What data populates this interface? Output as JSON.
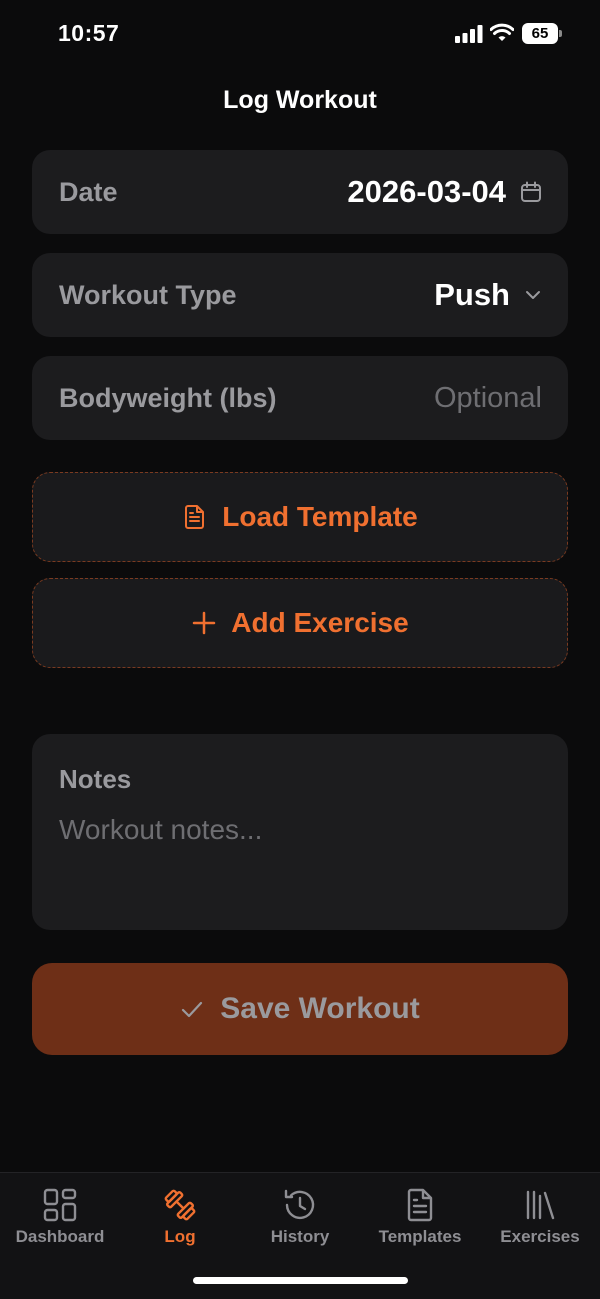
{
  "status_bar": {
    "time": "10:57",
    "battery": "65"
  },
  "header": {
    "title": "Log Workout"
  },
  "form": {
    "date": {
      "label": "Date",
      "value": "2026-03-04",
      "icon": "calendar-icon"
    },
    "workout_type": {
      "label": "Workout Type",
      "value": "Push",
      "icon": "chevron-down-icon"
    },
    "bodyweight": {
      "label": "Bodyweight (lbs)",
      "placeholder": "Optional"
    }
  },
  "actions": {
    "load_template": {
      "label": "Load Template",
      "icon": "document-icon"
    },
    "add_exercise": {
      "label": "Add Exercise",
      "icon": "plus-icon"
    }
  },
  "notes": {
    "label": "Notes",
    "placeholder": "Workout notes..."
  },
  "save": {
    "label": "Save Workout",
    "icon": "checkmark-icon"
  },
  "tab_bar": {
    "items": [
      {
        "label": "Dashboard",
        "icon": "dashboard-grid-icon",
        "active": false
      },
      {
        "label": "Log",
        "icon": "dumbbell-icon",
        "active": true
      },
      {
        "label": "History",
        "icon": "history-icon",
        "active": false
      },
      {
        "label": "Templates",
        "icon": "document-icon",
        "active": false
      },
      {
        "label": "Exercises",
        "icon": "library-icon",
        "active": false
      }
    ]
  },
  "colors": {
    "accent": "#f07030",
    "background": "#0b0b0c",
    "card": "#1c1c1e",
    "save_button": "#6e2f17"
  }
}
